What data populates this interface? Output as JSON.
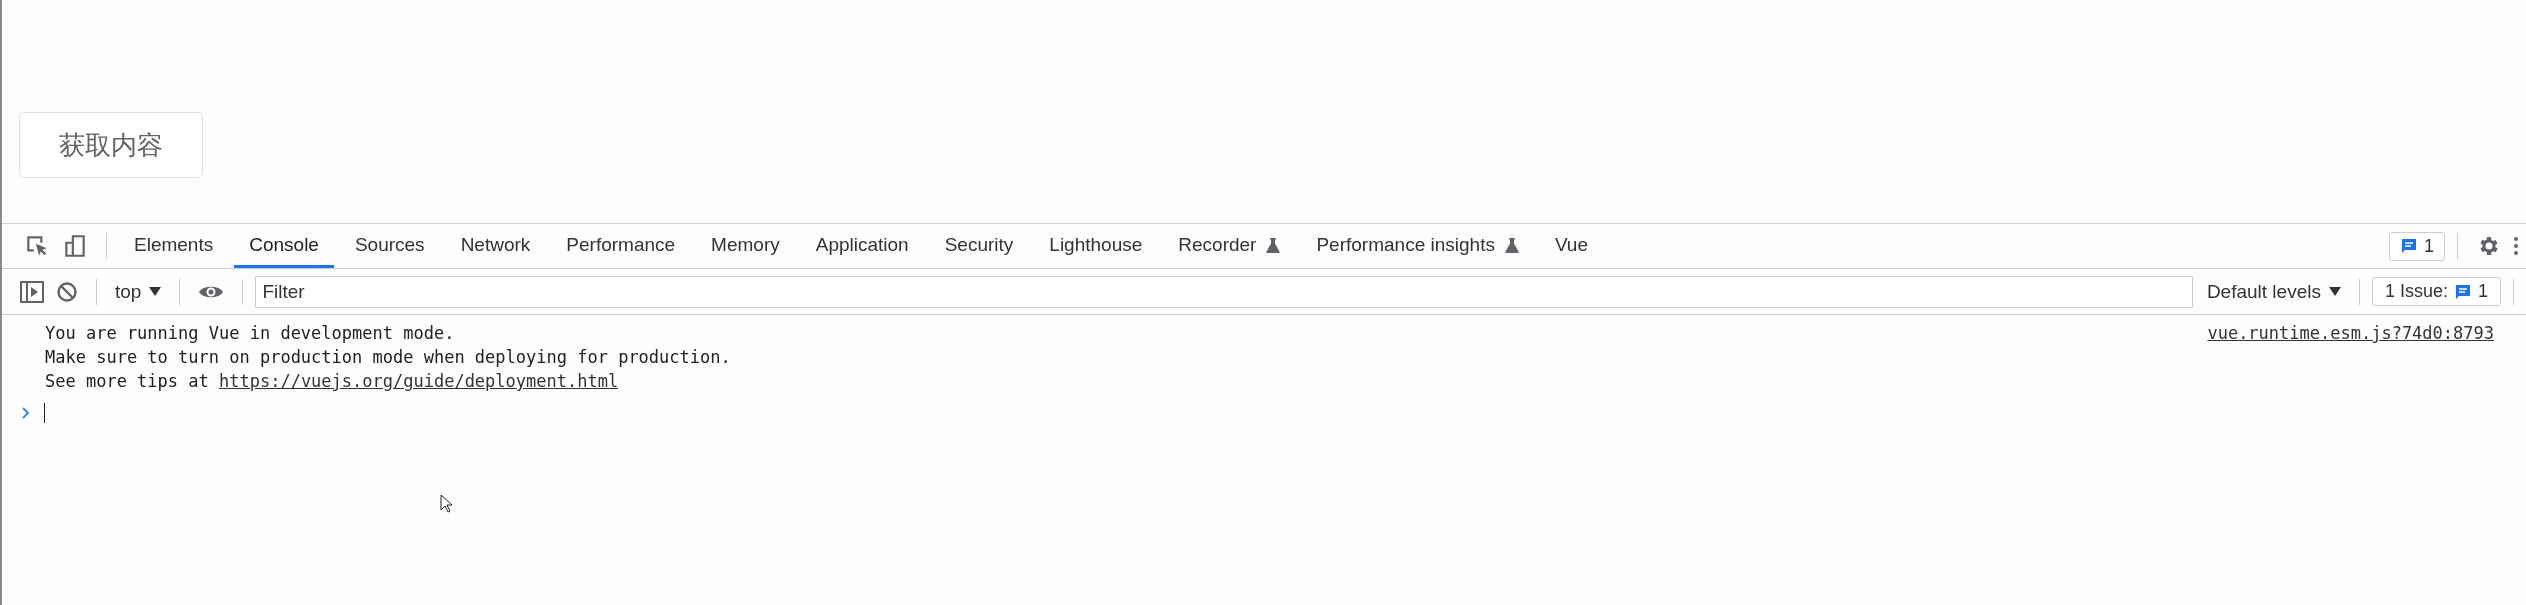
{
  "page": {
    "button": "获取内容"
  },
  "devtools": {
    "tabs": [
      {
        "label": "Elements",
        "selected": false,
        "experimental": false
      },
      {
        "label": "Console",
        "selected": true,
        "experimental": false
      },
      {
        "label": "Sources",
        "selected": false,
        "experimental": false
      },
      {
        "label": "Network",
        "selected": false,
        "experimental": false
      },
      {
        "label": "Performance",
        "selected": false,
        "experimental": false
      },
      {
        "label": "Memory",
        "selected": false,
        "experimental": false
      },
      {
        "label": "Application",
        "selected": false,
        "experimental": false
      },
      {
        "label": "Security",
        "selected": false,
        "experimental": false
      },
      {
        "label": "Lighthouse",
        "selected": false,
        "experimental": false
      },
      {
        "label": "Recorder",
        "selected": false,
        "experimental": true
      },
      {
        "label": "Performance insights",
        "selected": false,
        "experimental": true
      },
      {
        "label": "Vue",
        "selected": false,
        "experimental": false
      }
    ],
    "message_count": "1",
    "toolbar": {
      "context": "top",
      "filter": {
        "placeholder": "Filter"
      },
      "levels": "Default levels",
      "issues_label": "1 Issue:",
      "issues_count": "1"
    },
    "console": {
      "messages": [
        {
          "lines": [
            "You are running Vue in development mode.",
            "Make sure to turn on production mode when deploying for production."
          ],
          "link_prefix": "See more tips at ",
          "link": "https://vuejs.org/guide/deployment.html",
          "source": "vue.runtime.esm.js?74d0:8793"
        }
      ]
    }
  }
}
